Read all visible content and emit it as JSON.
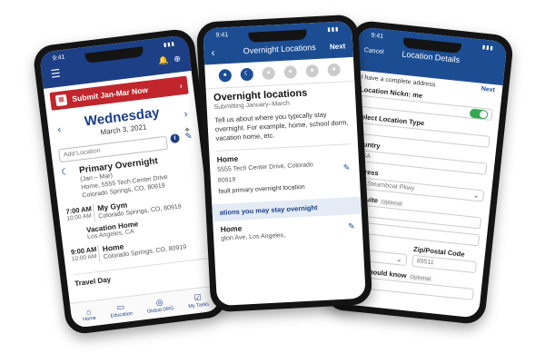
{
  "phone1": {
    "time": "9:41",
    "submit_label": "Submit Jan-Mar Now",
    "day": "Wednesday",
    "date": "March 3, 2021",
    "add_location_placeholder": "Add Location",
    "primary": {
      "title": "Primary Overnight",
      "range": "(Jan – Mar)",
      "address1": "Home, 5555 Tech Center Drive",
      "address2": "Colorado Springs, CO, 80919"
    },
    "entries": [
      {
        "time": "7:00 AM",
        "end": "10:00 AM",
        "title": "My Gym",
        "sub": "Colorado Springs, CO, 80919"
      },
      {
        "time": "9:00 AM",
        "end": "10:00 AM",
        "title": "Home",
        "sub": "Colorado Springs, CO, 80919"
      }
    ],
    "vacation": {
      "title": "Vacation Home",
      "sub": "Los Angeles, CA"
    },
    "travel_day": "Travel Day",
    "tabs": [
      "Home",
      "Education",
      "Global DRG",
      "My Tasks"
    ]
  },
  "phone2": {
    "time": "9:41",
    "title": "Overnight Locations",
    "next": "Next",
    "heading": "Overnight locations",
    "submitting": "Submitting January–March",
    "description": "Tell us about where you typically stay overnight. For example, home, school dorm, vacation home, etc.",
    "home": {
      "label": "Home",
      "address1": "5555 Tech Center Drive, Colorado",
      "address2": "80919",
      "default_text": "fault primary overnight location"
    },
    "band": "ations you may stay overnight",
    "home2": {
      "label": "Home",
      "address": "gton Ave, Los Angeles,"
    }
  },
  "phone3": {
    "time": "9:41",
    "cancel": "Cancel",
    "title": "Location Details",
    "next": "Next",
    "complete_address": "I have a complete address",
    "nickname_label": "Location Nickn: me",
    "type_label": "Select Location Type",
    "country_label": "Country",
    "country_value": "USA",
    "address_label": "Address",
    "address_value": "557 Steamboat Pkwy",
    "suite_label": "No./Suite",
    "optional": "Optional",
    "province_label": "ovince",
    "zip_label": "Zip/Postal Code",
    "zip_value": "89511",
    "know_label": "ase we should know",
    "know_optional": "Optional"
  }
}
